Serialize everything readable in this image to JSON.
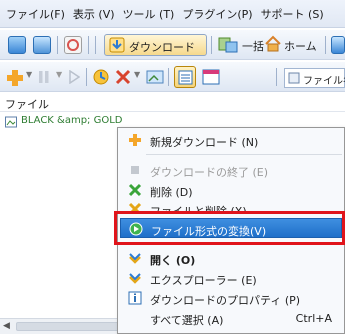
{
  "menubar": {
    "items": [
      {
        "label": "ファイル(F)"
      },
      {
        "label": "表示 (V)"
      },
      {
        "label": "ツール (T)"
      },
      {
        "label": "プラグイン(P)"
      },
      {
        "label": "サポート (S)"
      }
    ]
  },
  "toolbar1": {
    "download_label": "ダウンロード",
    "batch_label": "一括",
    "home_label": "ホーム"
  },
  "toolbar2": {
    "filename_label": "ファイル名"
  },
  "list": {
    "header": "ファイル",
    "rows": [
      {
        "name": "BLACK &amp; GOLD"
      }
    ]
  },
  "context_menu": {
    "items": [
      {
        "label": "新規ダウンロード (N)",
        "icon": "plus-icon",
        "state": "normal"
      },
      {
        "label": "ダウンロードの終了 (E)",
        "icon": "stop-icon",
        "state": "disabled"
      },
      {
        "label": "削除 (D)",
        "icon": "delete-icon",
        "state": "normal"
      },
      {
        "label": "ファイルと削除 (X)",
        "icon": "delete-file-icon",
        "state": "normal"
      },
      {
        "label": "ファイル形式の変換(V)",
        "icon": "convert-icon",
        "state": "highlighted"
      },
      {
        "label": "開く (O)",
        "icon": "open-icon",
        "state": "bold"
      },
      {
        "label": "エクスプローラー (E)",
        "icon": "explorer-icon",
        "state": "normal"
      },
      {
        "label": "ダウンロードのプロパティ (P)",
        "icon": "properties-icon",
        "state": "normal"
      },
      {
        "label": "すべて選択 (A)",
        "icon": "",
        "state": "normal",
        "shortcut": "Ctrl+A"
      }
    ]
  },
  "colors": {
    "highlight": "#1f6fc9",
    "red_outline": "#e0141b",
    "file_text": "#2e7d32"
  }
}
